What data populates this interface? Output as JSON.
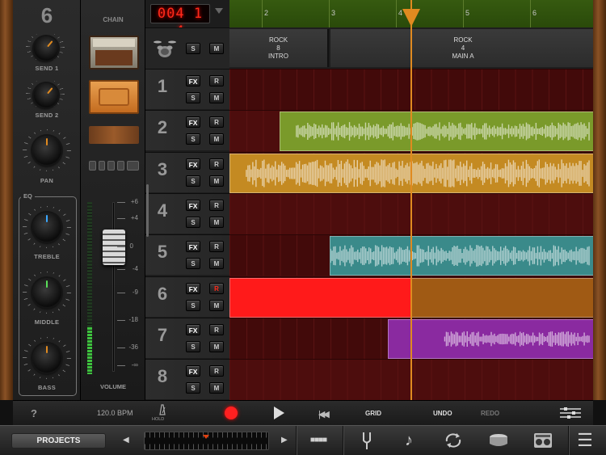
{
  "channel": {
    "number": "6",
    "knobs": [
      {
        "label": "SEND 1"
      },
      {
        "label": "SEND 2"
      },
      {
        "label": "PAN"
      },
      {
        "label": "TREBLE"
      },
      {
        "label": "MIDDLE"
      },
      {
        "label": "BASS"
      }
    ],
    "eq_label": "EQ"
  },
  "chain": {
    "title": "CHAIN",
    "volume_label": "VOLUME",
    "db_marks": [
      "+6",
      "+4",
      "0",
      "-4",
      "-9",
      "-18",
      "-36",
      "-∞"
    ]
  },
  "position_display": "004 1 4",
  "ruler": {
    "bars": [
      "2",
      "3",
      "4",
      "5",
      "6"
    ]
  },
  "sections": [
    {
      "lines": [
        "ROCK",
        "8",
        "INTRO"
      ]
    },
    {
      "lines": [
        "ROCK",
        "4",
        "MAIN A"
      ]
    }
  ],
  "drum_track": {
    "solo": "S",
    "mute": "M"
  },
  "tracks": [
    {
      "num": "1",
      "fx": "FX",
      "rec": "R",
      "solo": "S",
      "mute": "M"
    },
    {
      "num": "2",
      "fx": "FX",
      "rec": "R",
      "solo": "S",
      "mute": "M"
    },
    {
      "num": "3",
      "fx": "FX",
      "rec": "R",
      "solo": "S",
      "mute": "M"
    },
    {
      "num": "4",
      "fx": "FX",
      "rec": "R",
      "solo": "S",
      "mute": "M"
    },
    {
      "num": "5",
      "fx": "FX",
      "rec": "R",
      "solo": "S",
      "mute": "M"
    },
    {
      "num": "6",
      "fx": "FX",
      "rec": "R",
      "solo": "S",
      "mute": "M"
    },
    {
      "num": "7",
      "fx": "FX",
      "rec": "R",
      "solo": "S",
      "mute": "M"
    },
    {
      "num": "8",
      "fx": "FX",
      "rec": "R",
      "solo": "S",
      "mute": "M"
    }
  ],
  "armed_track": "6",
  "colors": {
    "track2": "#7a9a2a",
    "track3": "#c48a22",
    "track5": "#3a8a8a",
    "track6_record": "#ff1a1a",
    "track6_rest": "#a05a14",
    "track7": "#8a2aa0",
    "playhead": "#e08a20",
    "lcd": "#ff2a1a"
  },
  "transport": {
    "help": "?",
    "tempo": "120.0 BPM",
    "hold": "HOLD",
    "grid": "GRID",
    "undo": "UNDO",
    "redo": "REDO"
  },
  "toolbar": {
    "projects": "PROJECTS",
    "icons": [
      "beat-grid-icon",
      "tuning-fork-icon",
      "music-note-icon",
      "loop-icon",
      "drum-icon",
      "amp-icon",
      "menu-icon"
    ]
  }
}
